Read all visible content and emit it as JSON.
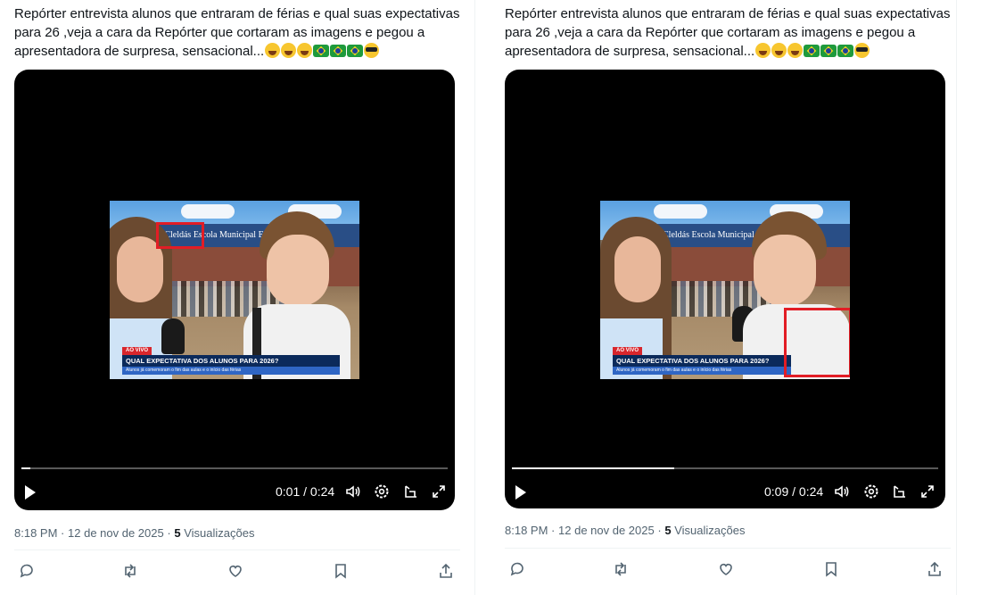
{
  "posts": [
    {
      "tweet_text": "Repórter entrevista alunos que entraram de férias e qual suas expectativas para 26 ,veja a cara da Repórter que cortaram as imagens e pegou a apresentadora de surpresa, sensacional...",
      "emojis": [
        "rolling-laughing",
        "grinning-tears",
        "rolling-laughing",
        "brazil-flag",
        "brazil-flag",
        "brazil-flag",
        "sunglasses-face"
      ],
      "video": {
        "sign_text": "es. Cleldás  Escola Municipal   Elisa d",
        "chyron_tag": "AO VIVO",
        "chyron_title": "QUAL EXPECTATIVA DOS ALUNOS PARA 2026?",
        "chyron_sub": "Alunos já comemoram o fim das aulas e o início das férias",
        "progress": 0.02,
        "time": "0:01 / 0:24",
        "highlight_target": "school-sign"
      },
      "meta": {
        "time": "8:18 PM",
        "date": "12 de nov de 2025",
        "views_count": "5",
        "views_label": "Visualizações"
      }
    },
    {
      "tweet_text": "Repórter entrevista alunos que entraram de férias e qual suas expectativas para 26 ,veja a cara da Repórter que cortaram as imagens e pegou a apresentadora de surpresa, sensacional...",
      "emojis": [
        "rolling-laughing",
        "grinning-tears",
        "rolling-laughing",
        "brazil-flag",
        "brazil-flag",
        "brazil-flag",
        "sunglasses-face"
      ],
      "video": {
        "sign_text": "Cleldás  Escola Municipal     Elisa d",
        "chyron_tag": "AO VIVO",
        "chyron_title": "QUAL EXPECTATIVA DOS ALUNOS PARA 2026?",
        "chyron_sub": "Alunos já comemoram o fim das aulas e o início das férias",
        "progress": 0.38,
        "time": "0:09 / 0:24",
        "highlight_target": "boy-hand"
      },
      "meta": {
        "time": "8:18 PM",
        "date": "12 de nov de 2025",
        "views_count": "5",
        "views_label": "Visualizações"
      }
    }
  ],
  "meta_separator": "·",
  "colors": {
    "highlight": "#e21d25",
    "chyron_bg": "#0b2a5b",
    "chyron_tag": "#d8262c"
  },
  "icons": {
    "controls": [
      "play-icon",
      "volume-icon",
      "settings-icon",
      "pip-icon",
      "fullscreen-icon"
    ],
    "actions": [
      "reply-icon",
      "repost-icon",
      "like-icon",
      "bookmark-icon",
      "share-icon"
    ]
  }
}
